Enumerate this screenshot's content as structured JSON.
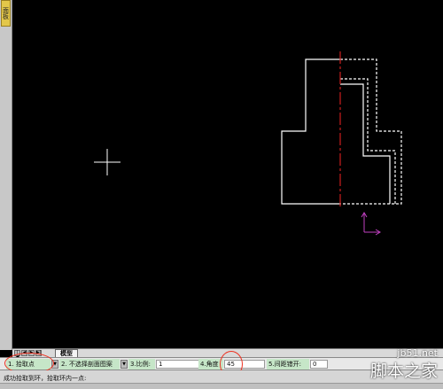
{
  "side_panel": {
    "tab_label": "面板"
  },
  "layout_tabs": {
    "nav_first": "|◀",
    "nav_prev": "◀",
    "nav_next": "▶",
    "nav_last": "▶|",
    "active": "模型"
  },
  "command_bar": {
    "option1": "1. 拾取点",
    "option2": "2. 不选择剖面图案",
    "scale_label": "3.比例:",
    "scale_value": "1",
    "angle_label": "4.角度",
    "angle_value": "45",
    "gap_label": "5.间距错开:",
    "gap_value": "0",
    "dropdown": "▼"
  },
  "status": {
    "message": "成功拾取到环，拾取环内一点:"
  },
  "watermark": {
    "site": "jb51.net",
    "name": "脚本之家"
  },
  "colors": {
    "canvas_bg": "#000000",
    "geometry": "#ffffff",
    "center_line": "#cc1f1f",
    "ucs_icon": "#c040c0",
    "annotation": "#e33322",
    "field_bg": "#c6e6c8"
  }
}
